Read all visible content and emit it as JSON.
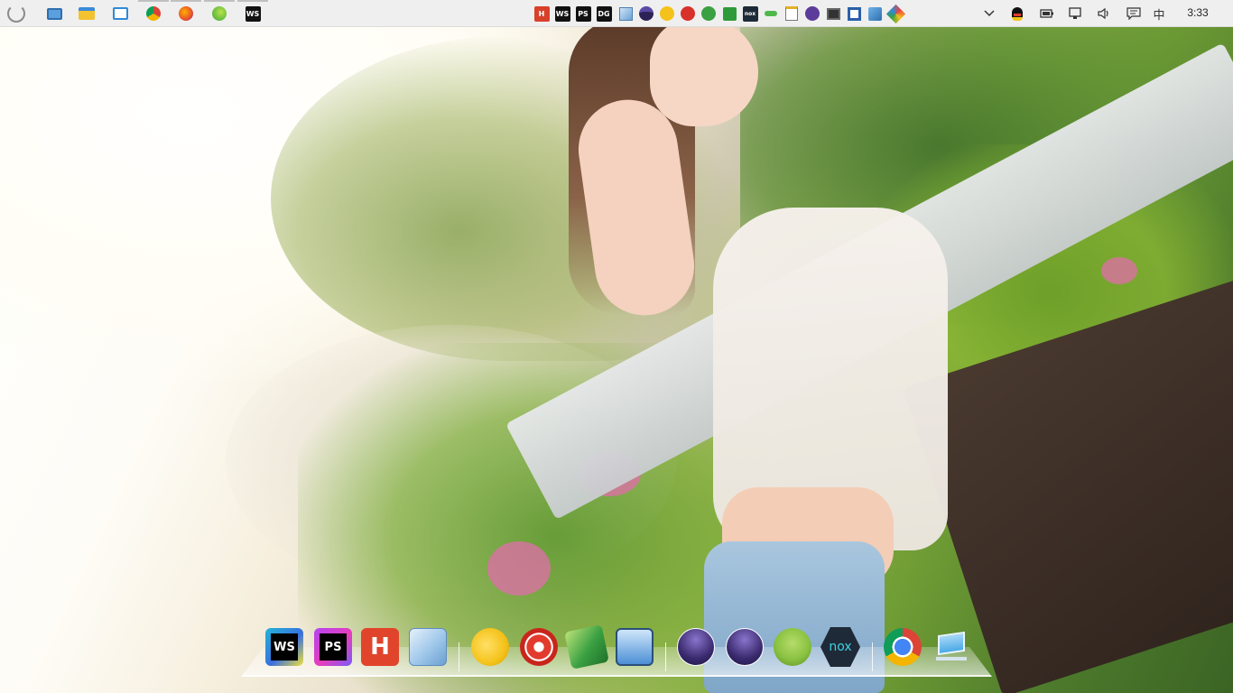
{
  "taskbar": {
    "pinned": [
      {
        "name": "start-button"
      },
      {
        "name": "photo-viewer-icon"
      },
      {
        "name": "file-explorer-icon"
      },
      {
        "name": "control-panel-icon"
      },
      {
        "name": "chrome-icon"
      },
      {
        "name": "firefox-icon"
      },
      {
        "name": "edge-icon"
      },
      {
        "name": "webstorm-icon",
        "label": "WS"
      }
    ],
    "tray_apps": [
      {
        "name": "hbuilder-icon",
        "label": "H"
      },
      {
        "name": "webstorm-tray-icon",
        "label": "WS"
      },
      {
        "name": "phpstorm-tray-icon",
        "label": "PS"
      },
      {
        "name": "datagrip-tray-icon",
        "label": "DG"
      },
      {
        "name": "box-app-icon"
      },
      {
        "name": "eclipse-tray-icon"
      },
      {
        "name": "yellow-app-icon"
      },
      {
        "name": "red-bird-icon"
      },
      {
        "name": "green-bird-icon"
      },
      {
        "name": "green-box-icon"
      },
      {
        "name": "nox-tray-icon",
        "label": "nox"
      },
      {
        "name": "green-dots-icon"
      },
      {
        "name": "notepad-icon"
      },
      {
        "name": "eclipse-purple-icon"
      },
      {
        "name": "monitor-app-icon"
      },
      {
        "name": "frame-app-icon"
      },
      {
        "name": "network-app-icon"
      },
      {
        "name": "colorful-app-icon"
      }
    ],
    "system": {
      "chevron": "chevron-down-icon",
      "qq": "qq-icon",
      "battery": "battery-icon",
      "network": "network-icon",
      "volume": "volume-icon",
      "notifications": "notification-icon",
      "ime": "中",
      "time": "3:33"
    }
  },
  "dock": {
    "items": [
      {
        "name": "webstorm",
        "label": "WS",
        "color": "#22b4d8"
      },
      {
        "name": "phpstorm",
        "label": "PS",
        "color": "#b345f1"
      },
      {
        "name": "hbuilder",
        "label": "H",
        "color": "#e0452b"
      },
      {
        "name": "virtualbox-cube",
        "label": "",
        "color": "#9fc7ea"
      },
      {
        "name": "yellow-blob-app",
        "label": "",
        "color": "#f4c21a"
      },
      {
        "name": "red-swirl-app",
        "label": "",
        "color": "#e23b2e"
      },
      {
        "name": "green-bird-app",
        "label": "",
        "color": "#3aa042"
      },
      {
        "name": "remote-desktop-app",
        "label": "",
        "color": "#4c8fd6"
      },
      {
        "name": "eclipse-1",
        "label": "",
        "color": "#3a2a6e"
      },
      {
        "name": "eclipse-2",
        "label": "",
        "color": "#3a2a6e"
      },
      {
        "name": "android-studio",
        "label": "",
        "color": "#8ac241"
      },
      {
        "name": "nox",
        "label": "nox",
        "color": "#1f2a38"
      },
      {
        "name": "chrome",
        "label": "",
        "color": "#db4437"
      },
      {
        "name": "desktop-monitor",
        "label": "",
        "color": "#4aa9e6"
      }
    ]
  }
}
